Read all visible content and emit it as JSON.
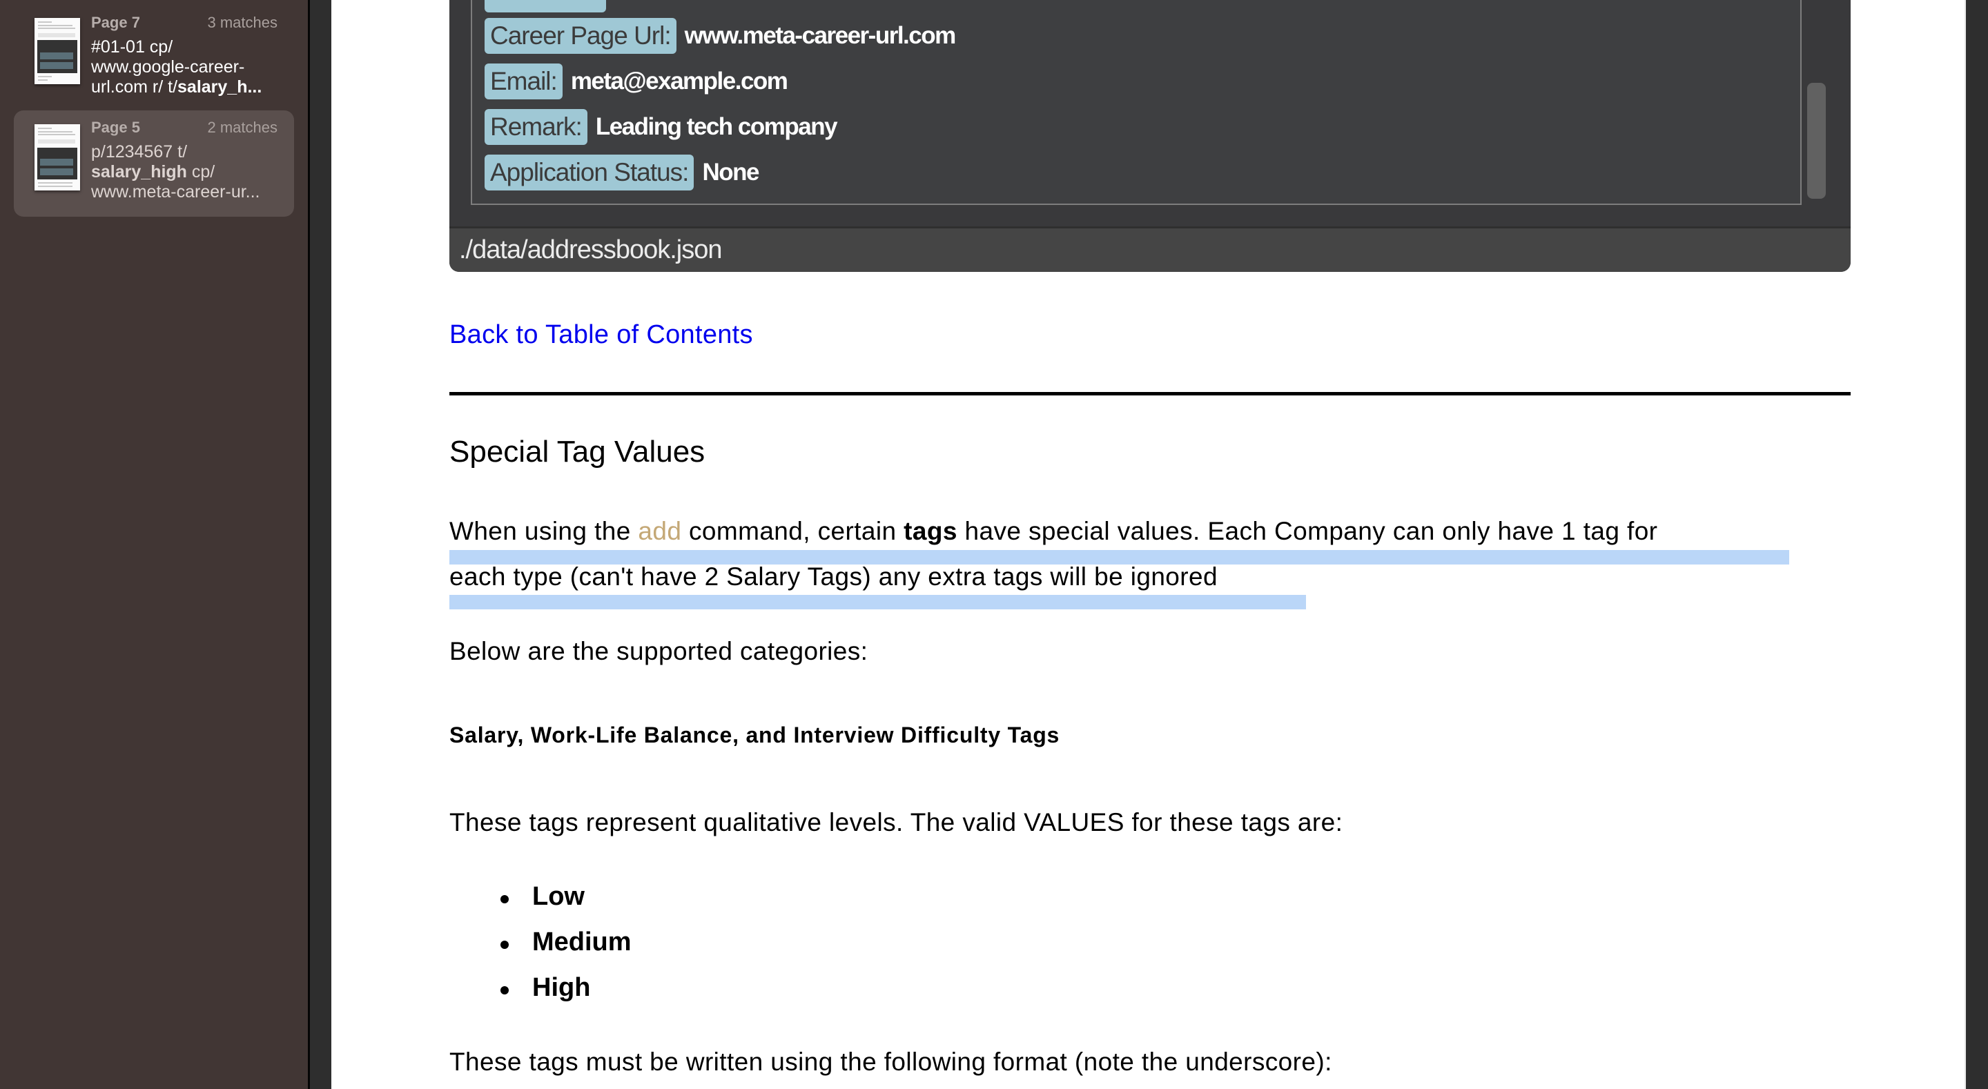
{
  "sidebar": {
    "results": [
      {
        "page": "Page 7",
        "matches": "3 matches",
        "snippet_pre": "#01-01 cp/\nwww.google-career-\nurl.com r/ t/",
        "snippet_bold": "salary_h...",
        "snippet_post": "",
        "selected": false
      },
      {
        "page": "Page 5",
        "matches": "2 matches",
        "snippet_pre": "p/1234567 t/\n",
        "snippet_bold": "salary_high",
        "snippet_post": " cp/\nwww.meta-career-ur...",
        "selected": true
      }
    ]
  },
  "embedded_app": {
    "fields": [
      {
        "label": "Career Page Url:",
        "value": "www.meta-career-url.com"
      },
      {
        "label": "Email:",
        "value": "meta@example.com"
      },
      {
        "label": "Remark:",
        "value": "Leading tech company"
      },
      {
        "label": "Application Status:",
        "value": "None"
      }
    ],
    "status_bar": "./data/addressbook.json"
  },
  "document": {
    "back_link": "Back to Table of Contents",
    "heading": "Special Tag Values",
    "intro": {
      "line1_pre": "When using the ",
      "line1_cmd": "add",
      "line1_mid": " command, certain ",
      "line1_bold": "tags",
      "line1_post": " have special values. Each Company can only have 1 tag for",
      "line2": "each type (can't have 2 Salary Tags) any extra tags will be ignored"
    },
    "categories_intro": "Below are the supported categories:",
    "subheading": "Salary, Work-Life Balance, and Interview Difficulty Tags",
    "levels_intro": "These tags represent qualitative levels. The valid VALUES for these tags are:",
    "levels": [
      "Low",
      "Medium",
      "High"
    ],
    "format_intro": "These tags must be written using the following format (note the underscore):"
  },
  "colors": {
    "sidebar_bg": "#413634",
    "selected_result_bg": "#5a4f4d",
    "link": "#0000ee",
    "command": "#c4a876",
    "search_highlight": "#bad6f8",
    "badge": "#9fc8d5"
  }
}
